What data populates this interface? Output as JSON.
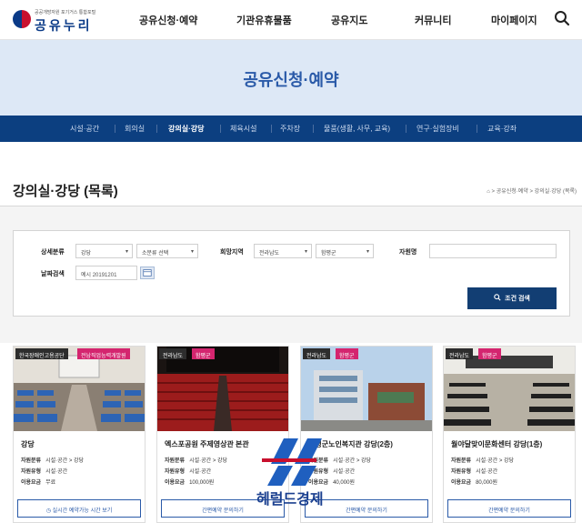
{
  "header": {
    "logo_sub": "공공개방자원 포기거스 통합포털",
    "logo_text": "공유누리",
    "nav": [
      "공유신청·예약",
      "기관유휴물품",
      "공유지도",
      "커뮤니티",
      "마이페이지"
    ]
  },
  "hero": {
    "title": "공유신청·예약"
  },
  "subnav": [
    "시설·공간",
    "회의실",
    "강의실·강당",
    "체육시설",
    "주차장",
    "물품(생활, 사무, 교육)",
    "연구·실험장비",
    "교육·강좌"
  ],
  "page": {
    "title": "강의실·강당 (목록)",
    "breadcrumb": "⌂ > 공유신청·예약 > 강의실·강당 (목록)"
  },
  "search": {
    "category_label": "상세분류",
    "category_value": "강당",
    "subcategory_value": "소분류 선택",
    "region_label": "희망지역",
    "region_value": "전라남도",
    "district_value": "함평군",
    "resource_name_label": "자원명",
    "resource_name_value": "",
    "date_label": "날짜검색",
    "date_placeholder": "예시 20191201",
    "submit_label": "조건 검색"
  },
  "cards": [
    {
      "badge1": "한국장애인고용공단",
      "badge2": "전남직업능력개발원",
      "title": "강당",
      "type_label": "자원분류",
      "type_value": "시설·공간 > 강당",
      "kind_label": "자원유형",
      "kind_value": "시설·공간",
      "fee_label": "이용요금",
      "fee_value": "무료",
      "button": "◷ 실시간 예약가능 시간 보기"
    },
    {
      "badge1": "전라남도",
      "badge2": "함평군",
      "title": "엑스포공원 주제영상관 본관",
      "type_label": "자원분류",
      "type_value": "시설·공간 > 강당",
      "kind_label": "자원유형",
      "kind_value": "시설·공간",
      "fee_label": "이용요금",
      "fee_value": "100,000원",
      "button": "간편예약 문의하기"
    },
    {
      "badge1": "전라남도",
      "badge2": "함평군",
      "title": "함평군노인복지관 강당(2층)",
      "type_label": "자원분류",
      "type_value": "시설·공간 > 강당",
      "kind_label": "자원유형",
      "kind_value": "시설·공간",
      "fee_label": "이용요금",
      "fee_value": "40,000원",
      "button": "간편예약 문의하기"
    },
    {
      "badge1": "전라남도",
      "badge2": "함평군",
      "title": "월야달맞이문화센터 강당(1층)",
      "type_label": "자원분류",
      "type_value": "시설·공간 > 강당",
      "kind_label": "자원유형",
      "kind_value": "시설·공간",
      "fee_label": "이용요금",
      "fee_value": "80,000원",
      "button": "간편예약 문의하기"
    }
  ],
  "watermark": {
    "text": "헤럴드경제"
  },
  "colors": {
    "primary": "#0c3f80",
    "accent": "#d4256f",
    "hero_bg": "#dde8f6"
  }
}
